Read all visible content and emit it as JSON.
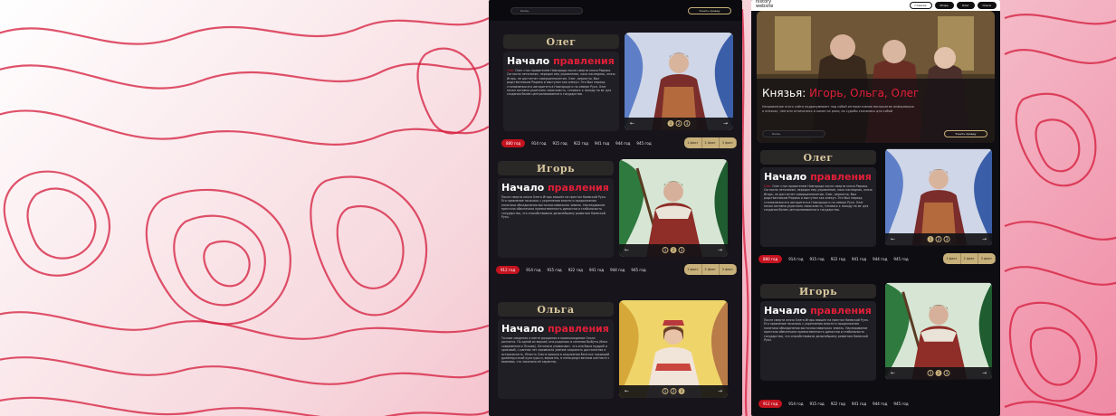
{
  "left_panel": {
    "search_label": "Князь",
    "search_button": "Узнать правду",
    "cards": [
      {
        "name": "Олег",
        "heading_white": "Начало",
        "heading_red": "правления",
        "body_accent": "Олег",
        "body": "Олег стал правителем Новгорода после смерти князя Рюрика. Согласно летописям, передан ему управление, пока наследник, князь Игорь, не достигнет совершеннолетия. Олег, вероятно, был родственником Рюрика и выступал как опекун. Это был период становления его авторитета в Новгороде и на севере Руси. Олег начал активно укреплять свою власть, готовясь к походу на юг для создания более централизованного государства.",
        "years": [
          "880 год",
          "914 год",
          "915 год",
          "922 год",
          "941 год",
          "944 год",
          "945 год"
        ],
        "active_year": 0,
        "tabs": [
          "1 факт",
          "2 факт",
          "3 факт"
        ],
        "dots": [
          "1",
          "2",
          "3"
        ],
        "active_dot": 0
      },
      {
        "name": "Игорь",
        "heading_white": "Начало",
        "heading_red": "правления",
        "body": "После смерти князя Олега Игорь взошёл на престол Киевской Руси. Его правление началось с укрепления власти и продолжения политики объединения восточнославянских земель. Наследование престола обеспечило преемственность династии и стабильность государства, что способствовало дальнейшему развитию Киевской Руси.",
        "years": [
          "912 год",
          "914 год",
          "915 год",
          "922 год",
          "941 год",
          "944 год",
          "945 год"
        ],
        "active_year": 0,
        "tabs": [
          "1 факт",
          "2 факт",
          "3 факт"
        ],
        "dots": [
          "1",
          "2",
          "3"
        ],
        "active_dot": 1
      },
      {
        "name": "Ольга",
        "heading_white": "Начало",
        "heading_red": "правления",
        "body": "Точные сведения о месте рождения и происхождении Ольги разнятся. По одной из версий, она родилась в селении Выбуты (близ современного Пскова). Летописи упоминают, что она была мудрой и красивой, с ранних лет проявляла умение сохранять достоинство и осторожность. Юность Ольги прошла в окружении богатых традиций древнерусской культуры и, вероятно, в непосредственном контакте с воинами, что закалило её характер.",
        "dots": [
          "1",
          "2",
          "3"
        ],
        "active_dot": 2
      }
    ]
  },
  "right_panel": {
    "logo_line1": "history",
    "logo_line2": "website",
    "nav": [
      "Главная",
      "Игорь",
      "Олег",
      "Ольга"
    ],
    "hero_title_white": "Князья:",
    "hero_title_red": "Игорь, Ольга, Олег",
    "hero_desc": "Направление этого сайта подразумевает под собой интерактивное восприятие информации о князьях, чем они отличились и какие их роли, их судьбы сказались для собой",
    "hero_select": "Князь",
    "hero_button": "Узнать правду",
    "cards": [
      {
        "name": "Олег",
        "heading_white": "Начало",
        "heading_red": "правления",
        "body_accent": "Олег",
        "body": "Олег стал правителем Новгорода после смерти князя Рюрика. Согласно летописям, передан ему управление, пока наследник, князь Игорь, не достигнет совершеннолетия. Олег, вероятно, был родственником Рюрика и выступал как опекун. Это был период становления его авторитета в Новгороде и на севере Руси. Олег начал активно укреплять свою власть, готовясь к походу на юг для создания более централизованного государства.",
        "years": [
          "880 год",
          "914 год",
          "915 год",
          "922 год",
          "941 год",
          "944 год",
          "945 год"
        ],
        "tabs": [
          "1 факт",
          "2 факт",
          "3 факт"
        ],
        "dots": [
          "1",
          "2",
          "3"
        ],
        "active_dot": 0
      },
      {
        "name": "Игорь",
        "heading_white": "Начало",
        "heading_red": "правления",
        "body": "После смерти князя Олега Игорь взошёл на престол Киевской Руси. Его правление началось с укрепления власти и продолжения политики объединения восточнославянских земель. Наследование престола обеспечило преемственность династии и стабильность государства, что способствовало дальнейшему развитию Киевской Руси.",
        "years": [
          "912 год",
          "914 год",
          "915 год",
          "922 год",
          "941 год",
          "944 год",
          "945 год"
        ],
        "tabs": [
          "1 факт",
          "2 факт",
          "3 факт"
        ],
        "dots": [
          "1",
          "2",
          "3"
        ],
        "active_dot": 1
      }
    ]
  },
  "colors": {
    "accent_red": "#e21f38",
    "gold": "#c7b07a",
    "panel_bg": "#17151b"
  }
}
